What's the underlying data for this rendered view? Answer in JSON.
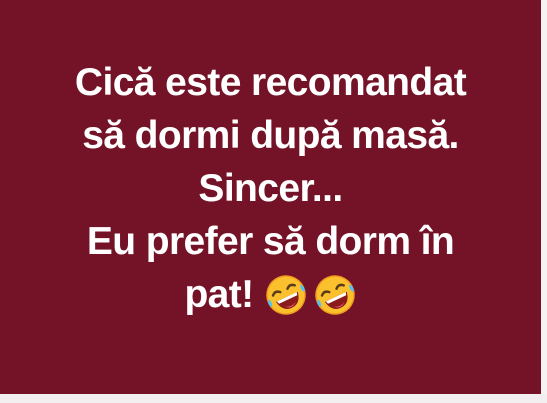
{
  "post": {
    "background_color": "#741327",
    "text_color": "#ffffff",
    "lines": [
      "Cică este recomandat",
      "să dormi după masă.",
      "Sincer...",
      "Eu prefer să dorm în"
    ],
    "last_line": "pat!",
    "emojis": [
      "rolling-on-floor-laughing-icon",
      "rolling-on-floor-laughing-icon"
    ]
  }
}
